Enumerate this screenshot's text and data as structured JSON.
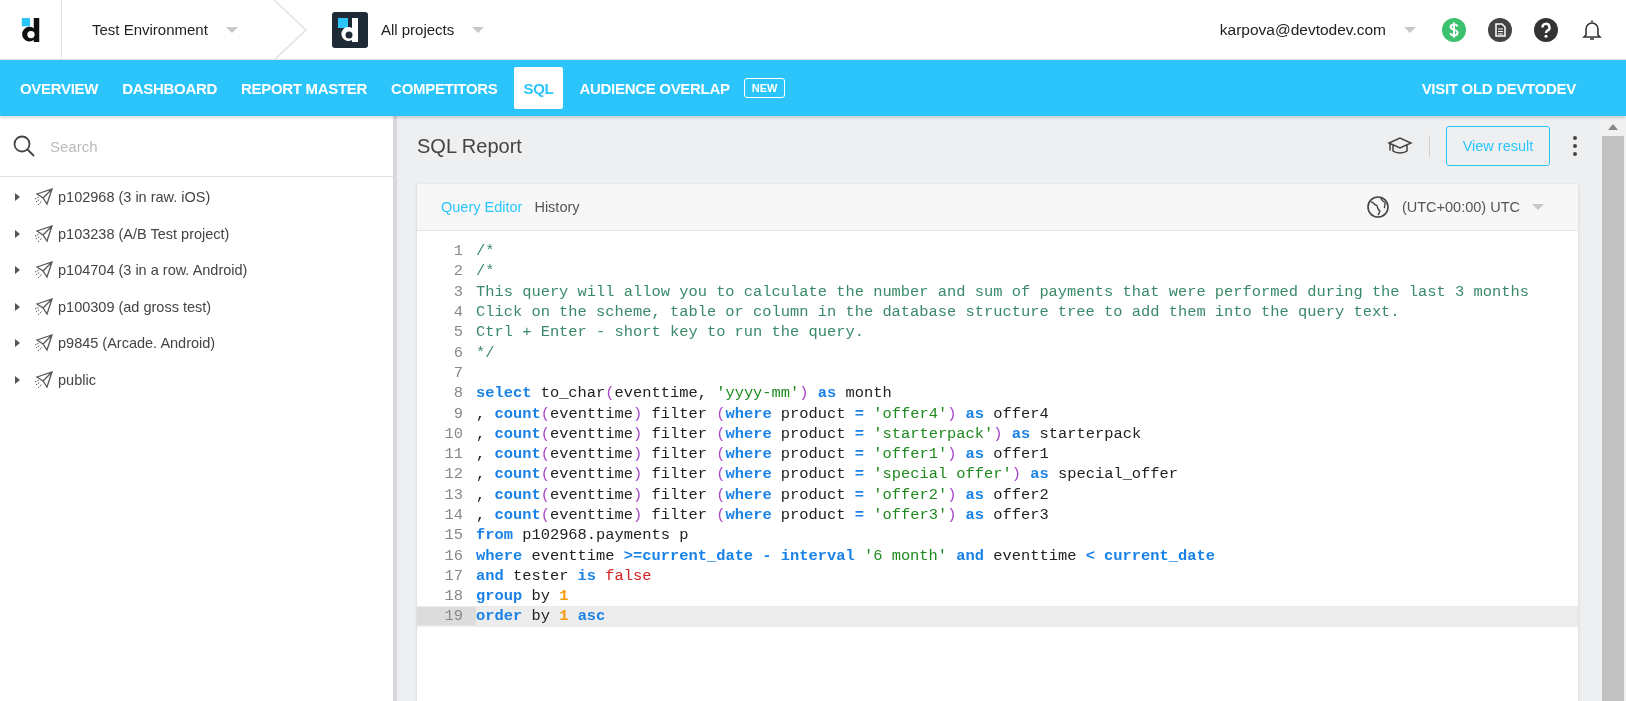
{
  "header": {
    "environment": "Test Environment",
    "project": "All projects",
    "user_email": "karpova@devtodev.com"
  },
  "nav": {
    "tabs": [
      {
        "label": "OVERVIEW",
        "selected": false
      },
      {
        "label": "DASHBOARD",
        "selected": false
      },
      {
        "label": "REPORT MASTER",
        "selected": false
      },
      {
        "label": "COMPETITORS",
        "selected": false
      },
      {
        "label": "SQL",
        "selected": true
      },
      {
        "label": "AUDIENCE OVERLAP",
        "selected": false,
        "badge": "NEW"
      }
    ],
    "link": "VISIT OLD DEVTODEV"
  },
  "sidebar": {
    "search": {
      "placeholder": "Search"
    },
    "items": [
      {
        "label": "p102968 (3 in raw. iOS)",
        "expanded": false
      },
      {
        "label": "p103238 (A/B Test project)",
        "expanded": false
      },
      {
        "label": "p104704 (3 in a row. Android)",
        "expanded": false
      },
      {
        "label": "p100309 (ad gross test)",
        "expanded": false
      },
      {
        "label": "p9845 (Arcade. Android)",
        "expanded": false
      },
      {
        "label": "public",
        "expanded": false
      }
    ]
  },
  "report": {
    "title": "SQL Report",
    "button": "View result",
    "tabs": [
      {
        "label": "Query Editor",
        "selected": true
      },
      {
        "label": "History",
        "selected": false
      }
    ],
    "timezone": "(UTC+00:00) UTC",
    "lines": [
      {
        "number": "1",
        "current": false,
        "tokens": [
          {
            "kind": "comment",
            "text": "/*"
          }
        ]
      },
      {
        "number": "2",
        "current": false,
        "tokens": [
          {
            "kind": "comment",
            "text": "/*"
          }
        ]
      },
      {
        "number": "3",
        "current": false,
        "tokens": [
          {
            "kind": "comment",
            "text": "This query will allow you to calculate the number and sum of payments that were performed during the last 3 months"
          }
        ]
      },
      {
        "number": "4",
        "current": false,
        "tokens": [
          {
            "kind": "comment",
            "text": "Click on the scheme, table or column in the database structure tree to add them into the query text."
          }
        ]
      },
      {
        "number": "5",
        "current": false,
        "tokens": [
          {
            "kind": "comment",
            "text": "Ctrl + Enter - short key to run the query."
          }
        ]
      },
      {
        "number": "6",
        "current": false,
        "tokens": [
          {
            "kind": "comment",
            "text": "*/"
          }
        ]
      },
      {
        "number": "7",
        "current": false
      },
      {
        "number": "8",
        "current": false,
        "tokens": [
          {
            "kind": "keyword",
            "text": "select"
          },
          {
            "kind": "text",
            "text": " to_char"
          },
          {
            "kind": "paren",
            "text": "("
          },
          {
            "kind": "text",
            "text": "eventtime, "
          },
          {
            "kind": "string",
            "text": "'yyyy-mm'"
          },
          {
            "kind": "paren",
            "text": ")"
          },
          {
            "kind": "keyword",
            "text": " as"
          },
          {
            "kind": "text",
            "text": " month"
          }
        ]
      },
      {
        "number": "9",
        "current": false,
        "tokens": [
          {
            "kind": "text",
            "text": ", "
          },
          {
            "kind": "keyword",
            "text": "count"
          },
          {
            "kind": "paren",
            "text": "("
          },
          {
            "kind": "text",
            "text": "eventtime"
          },
          {
            "kind": "paren",
            "text": ")"
          },
          {
            "kind": "text",
            "text": " filter "
          },
          {
            "kind": "paren",
            "text": "("
          },
          {
            "kind": "keyword",
            "text": "where"
          },
          {
            "kind": "text",
            "text": " product "
          },
          {
            "kind": "keyword",
            "text": "= "
          },
          {
            "kind": "string",
            "text": "'offer4'"
          },
          {
            "kind": "paren",
            "text": ")"
          },
          {
            "kind": "keyword",
            "text": " as"
          },
          {
            "kind": "text",
            "text": " offer4"
          }
        ]
      },
      {
        "number": "10",
        "current": false,
        "tokens": [
          {
            "kind": "text",
            "text": ", "
          },
          {
            "kind": "keyword",
            "text": "count"
          },
          {
            "kind": "paren",
            "text": "("
          },
          {
            "kind": "text",
            "text": "eventtime"
          },
          {
            "kind": "paren",
            "text": ")"
          },
          {
            "kind": "text",
            "text": " filter "
          },
          {
            "kind": "paren",
            "text": "("
          },
          {
            "kind": "keyword",
            "text": "where"
          },
          {
            "kind": "text",
            "text": " product "
          },
          {
            "kind": "keyword",
            "text": "= "
          },
          {
            "kind": "string",
            "text": "'starterpack'"
          },
          {
            "kind": "paren",
            "text": ")"
          },
          {
            "kind": "keyword",
            "text": " as"
          },
          {
            "kind": "text",
            "text": " starterpack"
          }
        ]
      },
      {
        "number": "11",
        "current": false,
        "tokens": [
          {
            "kind": "text",
            "text": ", "
          },
          {
            "kind": "keyword",
            "text": "count"
          },
          {
            "kind": "paren",
            "text": "("
          },
          {
            "kind": "text",
            "text": "eventtime"
          },
          {
            "kind": "paren",
            "text": ")"
          },
          {
            "kind": "text",
            "text": " filter "
          },
          {
            "kind": "paren",
            "text": "("
          },
          {
            "kind": "keyword",
            "text": "where"
          },
          {
            "kind": "text",
            "text": " product "
          },
          {
            "kind": "keyword",
            "text": "= "
          },
          {
            "kind": "string",
            "text": "'offer1'"
          },
          {
            "kind": "paren",
            "text": ")"
          },
          {
            "kind": "keyword",
            "text": " as"
          },
          {
            "kind": "text",
            "text": " offer1"
          }
        ]
      },
      {
        "number": "12",
        "current": false,
        "tokens": [
          {
            "kind": "text",
            "text": ", "
          },
          {
            "kind": "keyword",
            "text": "count"
          },
          {
            "kind": "paren",
            "text": "("
          },
          {
            "kind": "text",
            "text": "eventtime"
          },
          {
            "kind": "paren",
            "text": ")"
          },
          {
            "kind": "text",
            "text": " filter "
          },
          {
            "kind": "paren",
            "text": "("
          },
          {
            "kind": "keyword",
            "text": "where"
          },
          {
            "kind": "text",
            "text": " product "
          },
          {
            "kind": "keyword",
            "text": "= "
          },
          {
            "kind": "string",
            "text": "'special offer'"
          },
          {
            "kind": "paren",
            "text": ")"
          },
          {
            "kind": "keyword",
            "text": " as"
          },
          {
            "kind": "text",
            "text": " special_offer"
          }
        ]
      },
      {
        "number": "13",
        "current": false,
        "tokens": [
          {
            "kind": "text",
            "text": ", "
          },
          {
            "kind": "keyword",
            "text": "count"
          },
          {
            "kind": "paren",
            "text": "("
          },
          {
            "kind": "text",
            "text": "eventtime"
          },
          {
            "kind": "paren",
            "text": ")"
          },
          {
            "kind": "text",
            "text": " filter "
          },
          {
            "kind": "paren",
            "text": "("
          },
          {
            "kind": "keyword",
            "text": "where"
          },
          {
            "kind": "text",
            "text": " product "
          },
          {
            "kind": "keyword",
            "text": "= "
          },
          {
            "kind": "string",
            "text": "'offer2'"
          },
          {
            "kind": "paren",
            "text": ")"
          },
          {
            "kind": "keyword",
            "text": " as"
          },
          {
            "kind": "text",
            "text": " offer2"
          }
        ]
      },
      {
        "number": "14",
        "current": false,
        "tokens": [
          {
            "kind": "text",
            "text": ", "
          },
          {
            "kind": "keyword",
            "text": "count"
          },
          {
            "kind": "paren",
            "text": "("
          },
          {
            "kind": "text",
            "text": "eventtime"
          },
          {
            "kind": "paren",
            "text": ")"
          },
          {
            "kind": "text",
            "text": " filter "
          },
          {
            "kind": "paren",
            "text": "("
          },
          {
            "kind": "keyword",
            "text": "where"
          },
          {
            "kind": "text",
            "text": " product "
          },
          {
            "kind": "keyword",
            "text": "= "
          },
          {
            "kind": "string",
            "text": "'offer3'"
          },
          {
            "kind": "paren",
            "text": ")"
          },
          {
            "kind": "keyword",
            "text": " as"
          },
          {
            "kind": "text",
            "text": " offer3"
          }
        ]
      },
      {
        "number": "15",
        "current": false,
        "tokens": [
          {
            "kind": "keyword",
            "text": "from"
          },
          {
            "kind": "text",
            "text": " p102968.payments p"
          }
        ]
      },
      {
        "number": "16",
        "current": false,
        "tokens": [
          {
            "kind": "keyword",
            "text": "where"
          },
          {
            "kind": "text",
            "text": " eventtime "
          },
          {
            "kind": "keyword",
            "text": ">=current_date - interval"
          },
          {
            "kind": "string",
            "text": " '6 month'"
          },
          {
            "kind": "keyword",
            "text": " and"
          },
          {
            "kind": "text",
            "text": " eventtime "
          },
          {
            "kind": "keyword",
            "text": "< current_date"
          }
        ]
      },
      {
        "number": "17",
        "current": false,
        "tokens": [
          {
            "kind": "keyword",
            "text": "and"
          },
          {
            "kind": "text",
            "text": " tester "
          },
          {
            "kind": "keyword",
            "text": "is"
          },
          {
            "kind": "literal",
            "text": " false"
          }
        ]
      },
      {
        "number": "18",
        "current": false,
        "tokens": [
          {
            "kind": "keyword",
            "text": "group"
          },
          {
            "kind": "text",
            "text": " by "
          },
          {
            "kind": "number",
            "text": "1"
          }
        ]
      },
      {
        "number": "19",
        "current": true,
        "tokens": [
          {
            "kind": "keyword",
            "text": "order"
          },
          {
            "kind": "text",
            "text": " by "
          },
          {
            "kind": "number",
            "text": "1"
          },
          {
            "kind": "keyword",
            "text": " asc"
          }
        ]
      }
    ]
  }
}
